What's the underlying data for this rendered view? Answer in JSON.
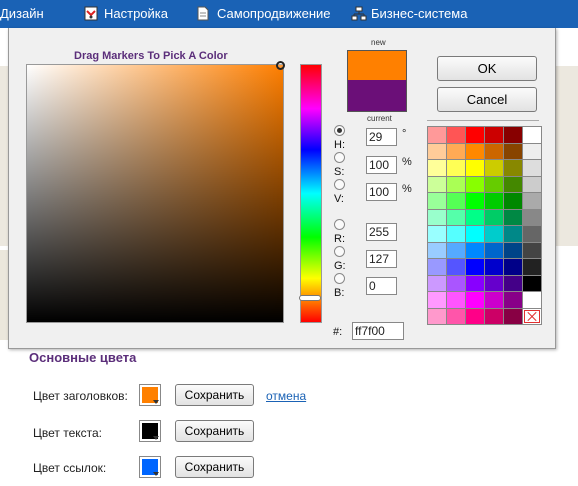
{
  "nav": [
    {
      "label": "Дизайн",
      "icon": "design-icon"
    },
    {
      "label": "Настройка",
      "icon": "settings-icon"
    },
    {
      "label": "Самопродвижение",
      "icon": "document-icon"
    },
    {
      "label": "Бизнес-система",
      "icon": "hierarchy-icon"
    }
  ],
  "picker": {
    "title": "Drag Markers To Pick A Color",
    "new_label": "new",
    "current_label": "current",
    "new_color": "#ff8000",
    "current_color": "#6b0f78",
    "ok_label": "OK",
    "cancel_label": "Cancel",
    "fields": {
      "h": {
        "label": "H:",
        "value": "29",
        "unit": "°"
      },
      "s": {
        "label": "S:",
        "value": "100",
        "unit": "%"
      },
      "v": {
        "label": "V:",
        "value": "100",
        "unit": "%"
      },
      "r": {
        "label": "R:",
        "value": "255"
      },
      "g": {
        "label": "G:",
        "value": "127"
      },
      "b": {
        "label": "B:",
        "value": "0"
      },
      "hex": {
        "label": "#:",
        "value": "ff7f00"
      }
    },
    "palette": [
      [
        "#ff9999",
        "#ff5555",
        "#ff0000",
        "#cc0000",
        "#880000",
        "#ffffff"
      ],
      [
        "#ffcc99",
        "#ffaa55",
        "#ff8800",
        "#cc6600",
        "#884400",
        "#eeeeee"
      ],
      [
        "#ffff99",
        "#ffff55",
        "#ffff00",
        "#cccc00",
        "#888800",
        "#dddddd"
      ],
      [
        "#ccff99",
        "#aaff55",
        "#88ff00",
        "#66cc00",
        "#448800",
        "#cccccc"
      ],
      [
        "#99ff99",
        "#55ff55",
        "#00ff00",
        "#00cc00",
        "#008800",
        "#aaaaaa"
      ],
      [
        "#99ffcc",
        "#55ffaa",
        "#00ff88",
        "#00cc66",
        "#008844",
        "#888888"
      ],
      [
        "#99ffff",
        "#55ffff",
        "#00ffff",
        "#00cccc",
        "#008888",
        "#666666"
      ],
      [
        "#99ccff",
        "#55aaff",
        "#0088ff",
        "#0066cc",
        "#004488",
        "#444444"
      ],
      [
        "#9999ff",
        "#5555ff",
        "#0000ff",
        "#0000cc",
        "#000088",
        "#222222"
      ],
      [
        "#cc99ff",
        "#aa55ff",
        "#8800ff",
        "#6600cc",
        "#440088",
        "#000000"
      ],
      [
        "#ff99ff",
        "#ff55ff",
        "#ff00ff",
        "#cc00cc",
        "#880088",
        "none"
      ],
      [
        "#ff99cc",
        "#ff55aa",
        "#ff0088",
        "#cc0066",
        "#880044",
        "none-x"
      ]
    ]
  },
  "section": {
    "title": "Основные цвета",
    "rows": [
      {
        "label": "Цвет заголовков:",
        "color": "#ff8000",
        "save": "Сохранить",
        "cancel": "отмена"
      },
      {
        "label": "Цвет текста:",
        "color": "#000000",
        "save": "Сохранить"
      },
      {
        "label": "Цвет ссылок:",
        "color": "#0066ff",
        "save": "Сохранить"
      }
    ]
  }
}
